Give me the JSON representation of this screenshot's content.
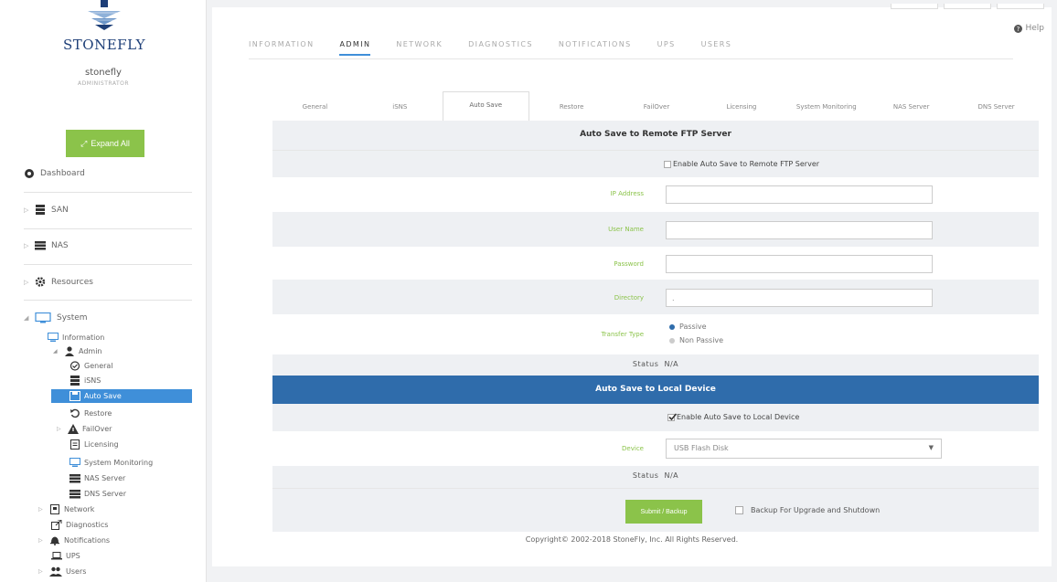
{
  "sidebar": {
    "logo_text": "STONEFLY",
    "user_name": "stonefly",
    "user_role": "ADMINISTRATOR",
    "expand_label": "Expand All",
    "nav": {
      "dashboard": "Dashboard",
      "san": "SAN",
      "nas": "NAS",
      "resources": "Resources",
      "system": "System"
    },
    "tree": {
      "information": "Information",
      "admin": "Admin",
      "general": "General",
      "isns": "iSNS",
      "auto_save": "Auto Save",
      "restore": "Restore",
      "failover": "FailOver",
      "licensing": "Licensing",
      "system_monitoring": "System Monitoring",
      "nas_server": "NAS Server",
      "dns_server": "DNS Server",
      "network": "Network",
      "diagnostics": "Diagnostics",
      "notifications": "Notifications",
      "ups": "UPS",
      "users": "Users"
    }
  },
  "header": {
    "help_label": "Help",
    "tabs": [
      "INFORMATION",
      "ADMIN",
      "NETWORK",
      "DIAGNOSTICS",
      "NOTIFICATIONS",
      "UPS",
      "USERS"
    ],
    "active_tab": "ADMIN"
  },
  "subtabs": [
    "General",
    "iSNS",
    "Auto Save",
    "Restore",
    "FailOver",
    "Licensing",
    "System Monitoring",
    "NAS Server",
    "DNS Server"
  ],
  "active_subtab": "Auto Save",
  "ftp": {
    "title": "Auto Save to Remote FTP Server",
    "enable_label": "Enable Auto Save to Remote FTP Server",
    "enabled": false,
    "ip_label": "IP Address",
    "ip_value": "",
    "user_label": "User Name",
    "user_value": "",
    "password_label": "Password",
    "password_value": "",
    "directory_label": "Directory",
    "directory_value": ".",
    "transfer_label": "Transfer Type",
    "transfer_options": [
      "Passive",
      "Non Passive"
    ],
    "transfer_selected": "Passive",
    "status_label": "Status",
    "status_value": "N/A"
  },
  "local": {
    "title": "Auto Save to Local Device",
    "enable_label": "Enable Auto Save to Local Device",
    "enabled": true,
    "device_label": "Device",
    "device_value": "USB Flash Disk",
    "status_label": "Status",
    "status_value": "N/A"
  },
  "actions": {
    "submit_label": "Submit / Backup",
    "backup_label": "Backup For Upgrade and Shutdown",
    "backup_checked": false
  },
  "footer": {
    "copyright": "Copyright© 2002-2018 StoneFly, Inc. All Rights Reserved."
  },
  "colors": {
    "accent_green": "#8bc34a",
    "accent_blue": "#3f8fd9",
    "header_blue": "#2f6cab",
    "logo_blue": "#1e3f78"
  }
}
